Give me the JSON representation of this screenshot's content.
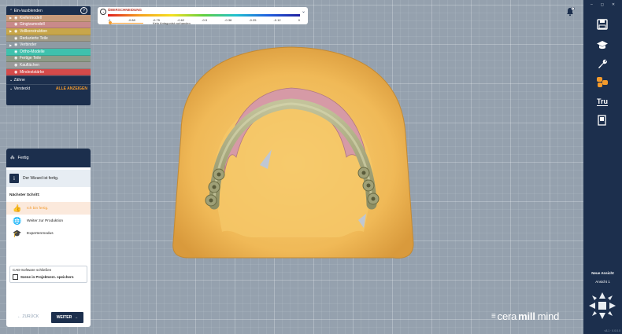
{
  "layers": {
    "header": "Ein-/ausblenden",
    "help": "?",
    "rows": [
      {
        "label": "Kiefermodell",
        "color": "#c79a7a",
        "caret": "▶"
      },
      {
        "label": "Gingivamodell",
        "color": "#c98a8a",
        "caret": ""
      },
      {
        "label": "Vollkonstruktion",
        "color": "#c8a64a",
        "caret": "▶"
      },
      {
        "label": "Reduzierte Teile",
        "color": "#a09a86",
        "caret": ""
      },
      {
        "label": "Verbinder",
        "color": "#8f9aa3",
        "caret": "▶"
      },
      {
        "label": "Ortho-Modelle",
        "color": "#3fc1ad",
        "caret": ""
      },
      {
        "label": "Fertige Teile",
        "color": "#8e9b87",
        "caret": ""
      },
      {
        "label": "Kauflächen",
        "color": "#9a9a9a",
        "caret": ""
      },
      {
        "label": "Mindeststärke",
        "color": "#d44a4a",
        "caret": ""
      }
    ],
    "teeth": "Zähne",
    "hidden": "Versteckt",
    "show_all": "ALLE ANZEIGEN"
  },
  "legend": {
    "title": "ÜBERSCHNEIDUNG",
    "ticks": [
      "-1",
      "-0.88",
      "-0.75",
      "-0.62",
      "-0.5",
      "-0.38",
      "-0.25",
      "-0.12",
      "0"
    ],
    "note": "Kein Antagonist vorhanden"
  },
  "wizard": {
    "title": "Fertig",
    "info": "Der Wizard ist fertig.",
    "next_step": "Nächster Schritt:",
    "options": [
      {
        "label": "Ich bin fertig.",
        "icon": "thumbs-up-icon",
        "selected": true
      },
      {
        "label": "Weiter zur Produktion",
        "icon": "globe-icon",
        "selected": false
      },
      {
        "label": "Expertenmodus",
        "icon": "graduation-cap-icon",
        "selected": false
      }
    ],
    "close_title": "CAD-Software schließen",
    "save_scene": "Szene in Projektverz. speichern",
    "back": "ZURÜCK",
    "continue": "WEITER"
  },
  "toolbar": {
    "minimize": "–",
    "maximize": "◻",
    "close": "✕",
    "tru_label": "Tru",
    "new_view": "Neue Ansicht",
    "view_name": "Ansicht 1",
    "version": "v3.1 · 0.0.0.0"
  },
  "notification_count": "1",
  "brand": {
    "prefix": "cera",
    "bold": "mill",
    "suffix": "mind"
  },
  "colors": {
    "navy": "#1c2f4d",
    "accent": "#f39a2c",
    "model": "#f1bd5e",
    "gingiva": "#d9a0a8",
    "bar": "#a2a37b"
  }
}
